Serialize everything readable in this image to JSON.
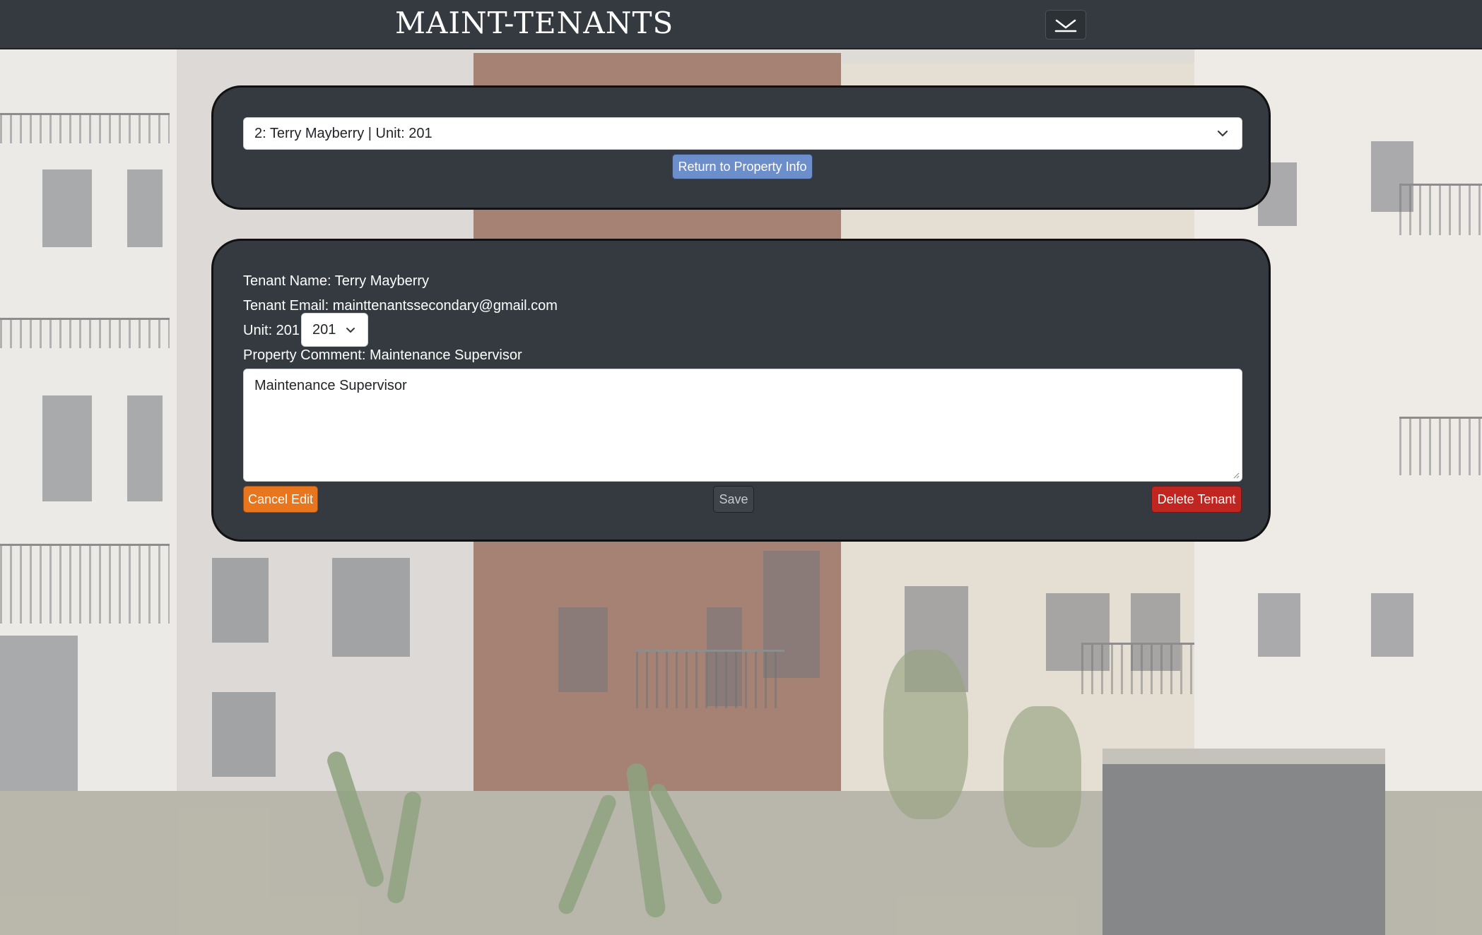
{
  "header": {
    "brand": "MAINT-TENANTS",
    "menu_icon": "chevron-down-icon"
  },
  "tenant_selector": {
    "selected": "2: Terry Mayberry | Unit: 201",
    "return_label": "Return to Property Info"
  },
  "tenant_details": {
    "name_line": "Tenant Name: Terry Mayberry",
    "email_line": "Tenant Email: mainttenantssecondary@gmail.com",
    "unit_line": "Unit: 201",
    "unit_selected": "201",
    "comment_line": "Property Comment: Maintenance Supervisor",
    "comment_value": "Maintenance Supervisor"
  },
  "actions": {
    "cancel_label": "Cancel Edit",
    "save_label": "Save",
    "delete_label": "Delete Tenant"
  },
  "colors": {
    "navbar": "#343a40",
    "card": "#343a40",
    "primary": "#6c8ecb",
    "warning": "#e8761f",
    "danger": "#c0251f"
  }
}
